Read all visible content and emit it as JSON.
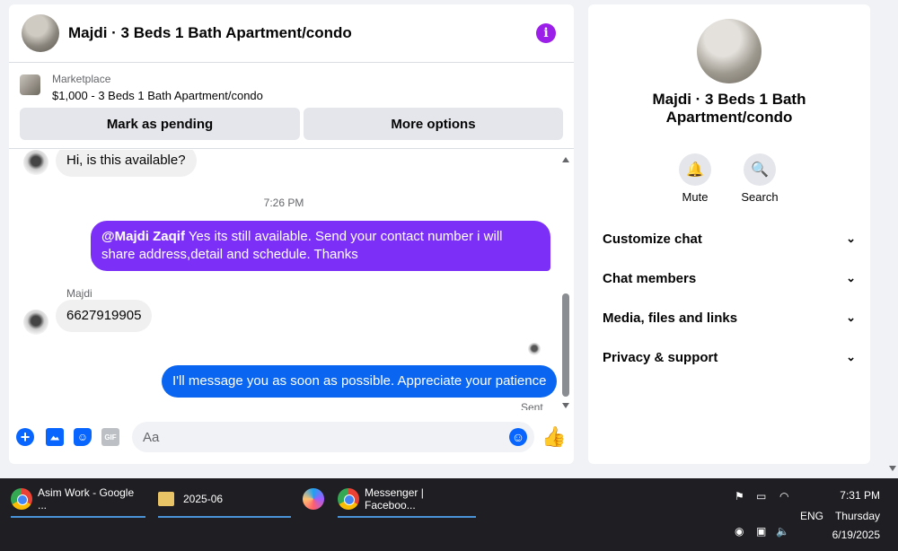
{
  "chat": {
    "title": "Majdi · 3 Beds 1 Bath Apartment/condo",
    "marketplace_label": "Marketplace",
    "listing": "$1,000 - 3 Beds 1 Bath Apartment/condo",
    "btn_pending": "Mark as pending",
    "btn_more": "More options"
  },
  "messages": {
    "msg1": "Hi, is this available?",
    "time": "7:26 PM",
    "msg2_mention": "@Majdi Zaqif",
    "msg2_text": " Yes its still available. Send your contact number i will share address,detail and schedule. Thanks",
    "sender": "Majdi",
    "msg3": "6627919905",
    "msg4": "I'll message you as soon as possible. Appreciate your patience",
    "status": "Sent"
  },
  "composer": {
    "placeholder": "Aa",
    "gif_label": "GIF"
  },
  "info": {
    "name": "Majdi · 3 Beds 1 Bath Apartment/condo",
    "mute": "Mute",
    "search": "Search",
    "rows": [
      "Customize chat",
      "Chat members",
      "Media, files and links",
      "Privacy & support"
    ]
  },
  "taskbar": {
    "task1": "Asim Work - Google ...",
    "task2": "2025-06",
    "task3": "Messenger | Faceboo...",
    "lang": "ENG",
    "time": "7:31 PM",
    "day": "Thursday",
    "date": "6/19/2025"
  },
  "colors": {
    "accent_purple": "#7b2ff7",
    "accent_blue": "#0a66f0",
    "taskbar": "#1f1f23"
  }
}
